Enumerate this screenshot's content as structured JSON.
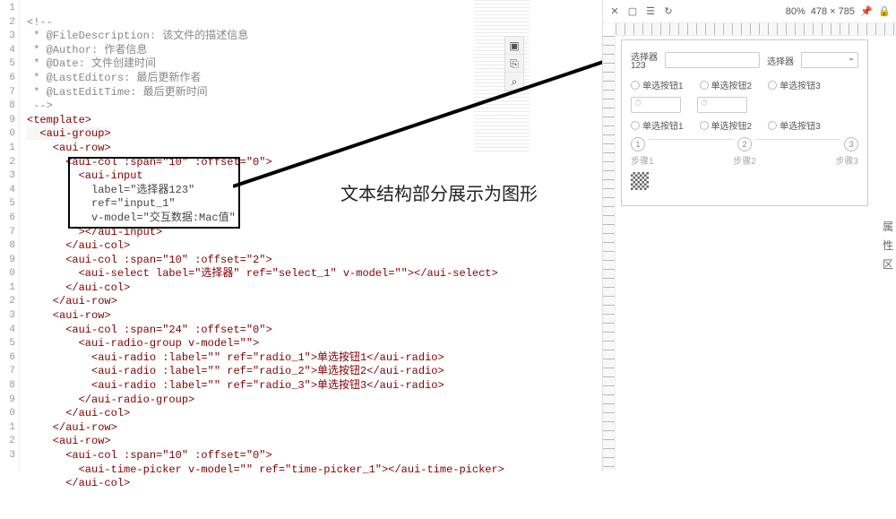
{
  "editor": {
    "gutter": [
      "1",
      "2",
      "3",
      "4",
      "5",
      "6",
      "7",
      "8",
      "9",
      "0",
      "1",
      "2",
      "3",
      "4",
      "5",
      "6",
      "7",
      "8",
      "9",
      "0",
      "1",
      "2",
      "3",
      "4",
      "5",
      "6",
      "7",
      "8",
      "9",
      "0",
      "1",
      "2",
      "3"
    ],
    "comment_open": "<!--",
    "c1": " * @FileDescription: 该文件的描述信息",
    "c2": " * @Author: 作者信息",
    "c3": " * @Date: 文件创建时间",
    "c4": " * @LastEditors: 最后更新作者",
    "c5": " * @LastEditTime: 最后更新时间",
    "comment_close": " -->",
    "t_template_o": "<template>",
    "t_group_o": "  <aui-group>",
    "t_row_o": "    <aui-row>",
    "t_col1_o": "      <aui-col :span=\"10\" :offset=\"0\">",
    "t_input_o": "        <aui-input",
    "t_input_a1": "          label=\"选择器123\"",
    "t_input_a2": "          ref=\"input_1\"",
    "t_input_a3": "          v-model=\"交互数据:Mac值\"",
    "t_input_c": "        ></aui-input>",
    "t_col_c": "      </aui-col>",
    "t_col2_o": "      <aui-col :span=\"10\" :offset=\"2\">",
    "t_select": "        <aui-select label=\"选择器\" ref=\"select_1\" v-model=\"\"></aui-select>",
    "t_row_c": "    </aui-row>",
    "t_col3_o": "      <aui-col :span=\"24\" :offset=\"0\">",
    "t_rg_o": "        <aui-radio-group v-model=\"\">",
    "t_r1": "          <aui-radio :label=\"\" ref=\"radio_1\">单选按钮1</aui-radio>",
    "t_r2": "          <aui-radio :label=\"\" ref=\"radio_2\">单选按钮2</aui-radio>",
    "t_r3": "          <aui-radio :label=\"\" ref=\"radio_3\">单选按钮3</aui-radio>",
    "t_rg_c": "        </aui-radio-group>",
    "t_col4_o": "      <aui-col :span=\"10\" :offset=\"0\">",
    "t_time": "        <aui-time-picker v-model=\"\" ref=\"time-picker_1\"></aui-time-picker>",
    "toolbar": {
      "i1": "▣",
      "i2": "⎘",
      "i3": "⌕"
    }
  },
  "annotation": {
    "text": "文本结构部分展示为图形"
  },
  "preview": {
    "toolbar": {
      "close": "✕",
      "box": "▢",
      "list": "☰",
      "refresh": "↻",
      "zoom": "80%",
      "dims": "478 × 785",
      "pin": "📌",
      "lock": "🔒"
    },
    "form": {
      "label1_top": "选择器",
      "label1_sub": "123",
      "label2": "选择器",
      "radio1": "单选按钮1",
      "radio2": "单选按钮2",
      "radio3": "单选按钮3",
      "radio4": "单选按钮1",
      "radio5": "单选按钮2",
      "radio6": "单选按钮3",
      "step1n": "1",
      "step2n": "2",
      "step3n": "3",
      "step1": "步骤1",
      "step2": "步骤2",
      "step3": "步骤3"
    },
    "side": {
      "a": "属",
      "b": "性",
      "c": "区"
    }
  }
}
